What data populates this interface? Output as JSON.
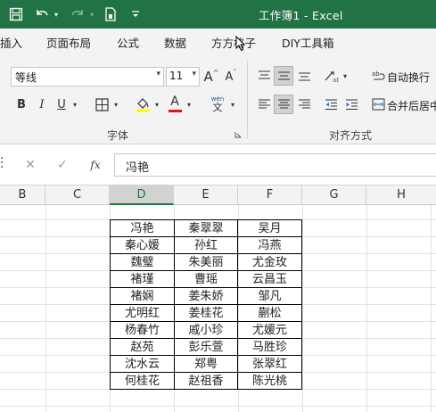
{
  "titlebar": {
    "title": "工作簿1  -  Excel",
    "icons": [
      "save-icon",
      "undo-icon",
      "redo-icon",
      "format-painter-icon",
      "customize-qat-icon"
    ],
    "bg_color": "#217346"
  },
  "menu": {
    "tabs": [
      "插入",
      "页面布局",
      "公式",
      "数据",
      "方方格子",
      "DIY工具箱"
    ]
  },
  "ribbon": {
    "font_name": "等线",
    "font_size": "11",
    "grow_font": "A",
    "shrink_font": "A",
    "bold": "B",
    "italic": "I",
    "underline": "U",
    "font_color_letter": "A",
    "phonetic_top": "wén",
    "phonetic_bottom": "文",
    "font_group_label": "字体",
    "align_group_label": "对齐方式",
    "wrap_text_label": "自动换行",
    "merge_center_label": "合并后居中"
  },
  "formula_bar": {
    "cancel": "✕",
    "enter": "✓",
    "fx": "fx",
    "value": "冯艳"
  },
  "grid": {
    "columns": [
      "B",
      "C",
      "D",
      "E",
      "F",
      "G",
      "H"
    ],
    "selected_column": "D",
    "table": [
      [
        "冯艳",
        "秦翠翠",
        "吴月"
      ],
      [
        "秦心媛",
        "孙红",
        "冯燕"
      ],
      [
        "魏璧",
        "朱美丽",
        "尤金玫"
      ],
      [
        "褚瑾",
        "曹瑶",
        "云昌玉"
      ],
      [
        "褚娴",
        "姜朱娇",
        "邹凡"
      ],
      [
        "尤明红",
        "姜桂花",
        "蒯松"
      ],
      [
        "杨春竹",
        "戚小珍",
        "尤媛元"
      ],
      [
        "赵苑",
        "彭乐萱",
        "马胜珍"
      ],
      [
        "沈水云",
        "郑粤",
        "张翠红"
      ],
      [
        "何桂花",
        "赵祖香",
        "陈光桃"
      ]
    ]
  }
}
